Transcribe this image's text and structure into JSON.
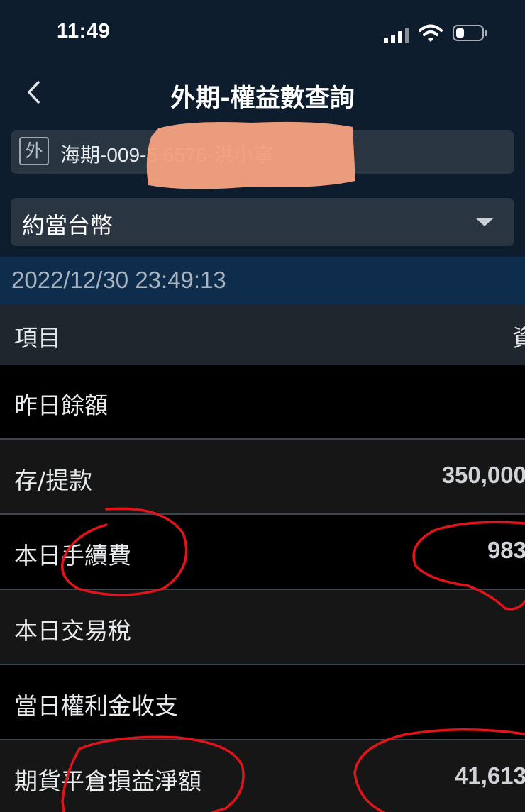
{
  "status_bar": {
    "time": "11:49"
  },
  "nav": {
    "title": "外期-權益數查詢"
  },
  "account": {
    "badge": "外",
    "text": "海期-009-5  6576-洪小寧"
  },
  "currency": {
    "selected": "約當台幣"
  },
  "timestamp": "2022/12/30 23:49:13",
  "table": {
    "headers": {
      "item": "項目",
      "amount": "資"
    },
    "rows": [
      {
        "label": "昨日餘額",
        "value": ""
      },
      {
        "label": "存/提款",
        "value": "350,000"
      },
      {
        "label": "本日手續費",
        "value": "983"
      },
      {
        "label": "本日交易稅",
        "value": ""
      },
      {
        "label": "當日權利金收支",
        "value": ""
      },
      {
        "label": "期貨平倉損益淨額",
        "value": "41,613"
      }
    ]
  },
  "colors": {
    "header_bg": "#0e1d2d",
    "date_bar": "#0e2d4d",
    "input_bg": "#293541",
    "annotation": "#e0141b",
    "redaction": "#f2a07f"
  }
}
